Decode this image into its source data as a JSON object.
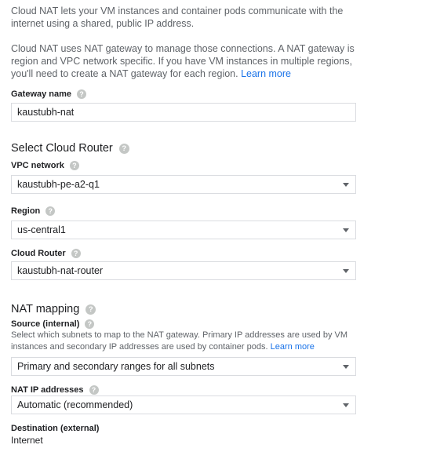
{
  "intro": {
    "paragraph1": "Cloud NAT lets your VM instances and container pods communicate with the internet using a shared, public IP address.",
    "paragraph2": "Cloud NAT uses NAT gateway to manage those connections. A NAT gateway is region and VPC network specific. If you have VM instances in multiple regions, you'll need to create a NAT gateway for each region.",
    "learn_more": "Learn more"
  },
  "gateway": {
    "label": "Gateway name",
    "value": "kaustubh-nat"
  },
  "cloud_router_section": {
    "title": "Select Cloud Router",
    "vpc_label": "VPC network",
    "vpc_value": "kaustubh-pe-a2-q1",
    "region_label": "Region",
    "region_value": "us-central1",
    "router_label": "Cloud Router",
    "router_value": "kaustubh-nat-router"
  },
  "nat_mapping": {
    "title": "NAT mapping",
    "source_label": "Source (internal)",
    "source_hint": "Select which subnets to map to the NAT gateway. Primary IP addresses are used by VM instances and secondary IP addresses are used by container pods.",
    "learn_more": "Learn more",
    "source_value": "Primary and secondary ranges for all subnets",
    "nat_ip_label": "NAT IP addresses",
    "nat_ip_value": "Automatic (recommended)",
    "destination_label": "Destination (external)",
    "destination_value": "Internet"
  },
  "icons": {
    "help": "?",
    "help_icon_name": "help-circle-icon",
    "dropdown_icon_name": "dropdown-caret-icon"
  },
  "colors": {
    "link": "#1a73e8",
    "text_primary": "#202124",
    "text_secondary": "#5f6368",
    "border": "#dadce0"
  }
}
